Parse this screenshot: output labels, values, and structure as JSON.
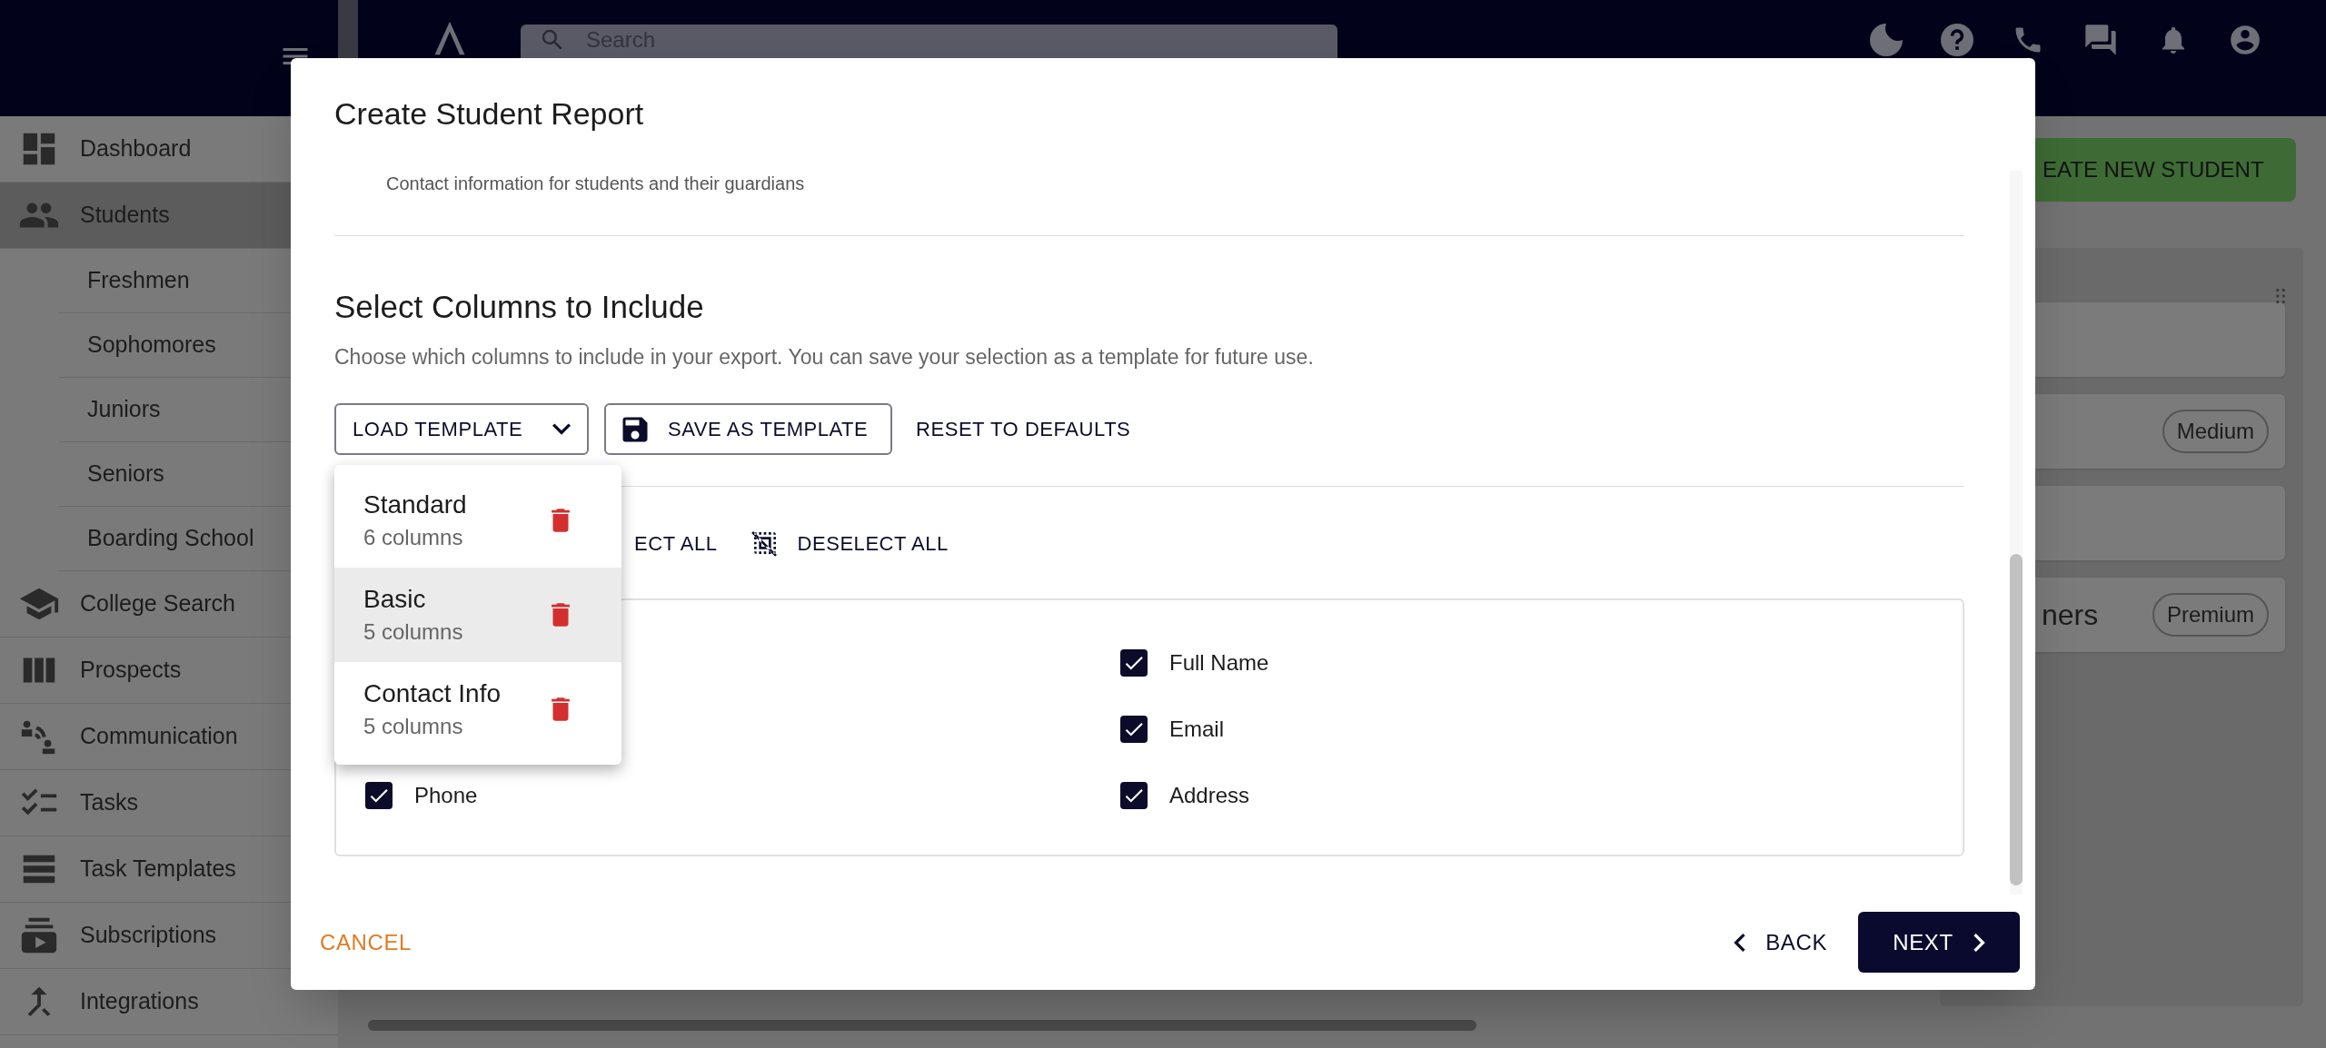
{
  "top_bar": {
    "search": {
      "placeholder": "Search"
    }
  },
  "sidebar": {
    "items": [
      {
        "label": "Dashboard",
        "selected": false
      },
      {
        "label": "Students",
        "selected": true,
        "children": [
          {
            "label": "Freshmen"
          },
          {
            "label": "Sophomores"
          },
          {
            "label": "Juniors"
          },
          {
            "label": "Seniors"
          },
          {
            "label": "Boarding School"
          }
        ]
      },
      {
        "label": "College Search",
        "selected": false
      },
      {
        "label": "Prospects",
        "selected": false
      },
      {
        "label": "Communication",
        "selected": false
      },
      {
        "label": "Tasks",
        "selected": false
      },
      {
        "label": "Task Templates",
        "selected": false
      },
      {
        "label": "Subscriptions",
        "selected": false
      },
      {
        "label": "Integrations",
        "selected": false
      }
    ]
  },
  "background": {
    "create_button": "EATE NEW STUDENT",
    "cards": [
      {
        "kind": "blank"
      },
      {
        "kind": "badge",
        "badge": "Medium"
      },
      {
        "kind": "blank"
      },
      {
        "kind": "badge",
        "text": "ners",
        "badge": "Premium"
      }
    ]
  },
  "dialog": {
    "title": "Create Student Report",
    "section_caption": "Contact information for students and their guardians",
    "heading": "Select Columns to Include",
    "description": "Choose which columns to include in your export. You can save your selection as a template for future use.",
    "load_template": "LOAD TEMPLATE",
    "save_template": "SAVE AS TEMPLATE",
    "reset": "RESET TO DEFAULTS",
    "select_all": "ECT ALL",
    "deselect_all": "DESELECT ALL",
    "column_rows": [
      {
        "right": {
          "label": "Full Name",
          "checked": true
        }
      },
      {
        "right": {
          "label": "Email",
          "checked": true
        }
      },
      {
        "left": {
          "label": "Phone",
          "checked": true
        },
        "right": {
          "label": "Address",
          "checked": true
        }
      }
    ],
    "template_menu": [
      {
        "name": "Standard",
        "count": "6 columns",
        "highlighted": false
      },
      {
        "name": "Basic",
        "count": "5 columns",
        "highlighted": true
      },
      {
        "name": "Contact Info",
        "count": "5 columns",
        "highlighted": false
      }
    ],
    "footer": {
      "cancel": "CANCEL",
      "back": "BACK",
      "next": "NEXT"
    }
  }
}
